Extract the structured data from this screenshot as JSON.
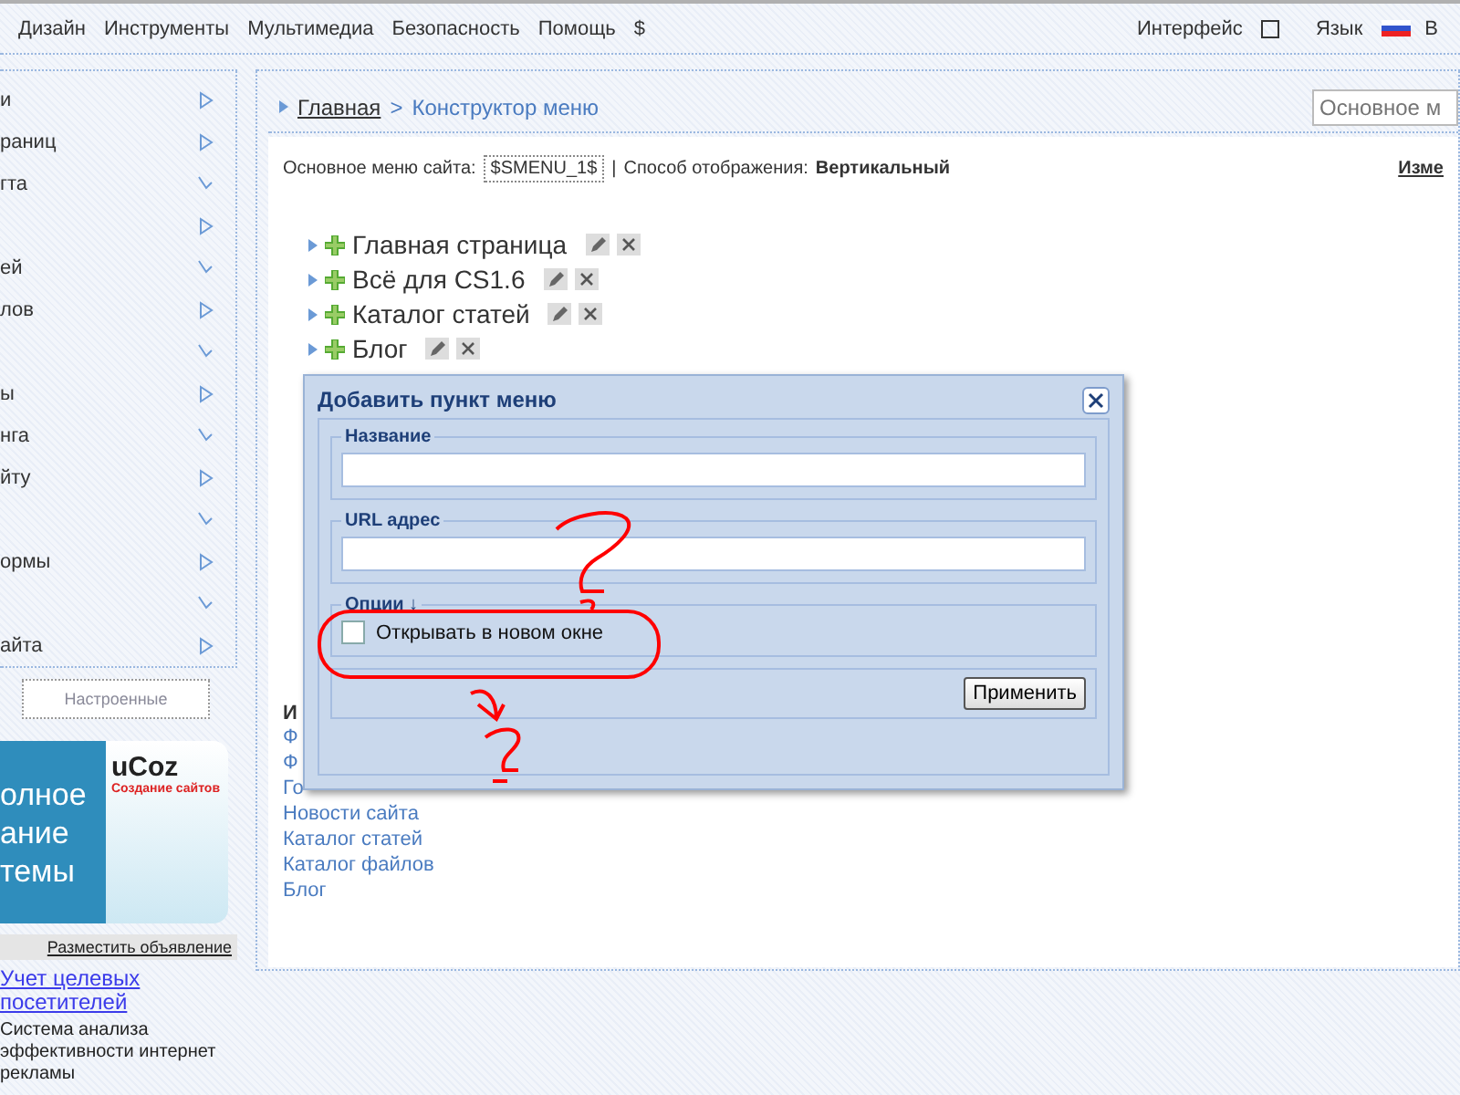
{
  "top_menu": [
    "Дизайн",
    "Инструменты",
    "Мультимедиа",
    "Безопасность",
    "Помощь",
    "$"
  ],
  "top_right": {
    "interface_label": "Интерфейс",
    "language_label": "Язык",
    "cut_item": "В"
  },
  "sidebar": {
    "items": [
      {
        "label": "и",
        "kind": "expand"
      },
      {
        "label": "раниц",
        "kind": "expand"
      },
      {
        "label": "гта",
        "kind": "collapse"
      },
      {
        "kind": "expand"
      },
      {
        "label": "ей",
        "kind": "collapse"
      },
      {
        "label": "лов",
        "kind": "expand"
      },
      {
        "kind": "collapse"
      },
      {
        "label": "ы",
        "kind": "expand"
      },
      {
        "label": "нга",
        "kind": "collapse"
      },
      {
        "label": "йту",
        "kind": "expand"
      },
      {
        "kind": "collapse"
      },
      {
        "label": "ормы",
        "kind": "expand"
      },
      {
        "kind": "collapse"
      },
      {
        "label": "айта",
        "kind": "expand"
      }
    ],
    "settings_tab": "Настроенные",
    "banner": {
      "lines": [
        "олное",
        "ание",
        "темы"
      ],
      "logo": "uCoz",
      "logo_caption": "Создание сайтов"
    },
    "ad_link": "Разместить объявление",
    "ad": {
      "title": "Учет целевых посетителей",
      "text": "Система анализа эффективности интернет рекламы"
    }
  },
  "breadcrumb": {
    "home": "Главная",
    "separator": ">",
    "current": "Конструктор меню"
  },
  "search": {
    "placeholder": "Основное м"
  },
  "menu_settings": {
    "menu_label": "Основное меню сайта:",
    "menu_code": "$SMENU_1$",
    "divider": "|",
    "mode_label": "Способ отображения:",
    "mode_value": "Вертикальный",
    "edit_link": "Изме"
  },
  "menu_tree": [
    {
      "label": "Главная страница"
    },
    {
      "label": "Всё для CS1.6"
    },
    {
      "label": "Каталог статей"
    },
    {
      "label": "Блог"
    }
  ],
  "links_heading": "И",
  "links": [
    "Ф",
    "Ф",
    "Го",
    "Новости сайта",
    "Каталог статей",
    "Каталог файлов",
    "Блог"
  ],
  "dialog": {
    "title": "Добавить пункт меню",
    "fields": [
      {
        "legend": "Название"
      },
      {
        "legend": "URL адрес"
      }
    ],
    "options_legend": "Опции ↓",
    "option": {
      "label": "Открывать в новом окне",
      "checked": false
    },
    "apply": "Применить"
  }
}
